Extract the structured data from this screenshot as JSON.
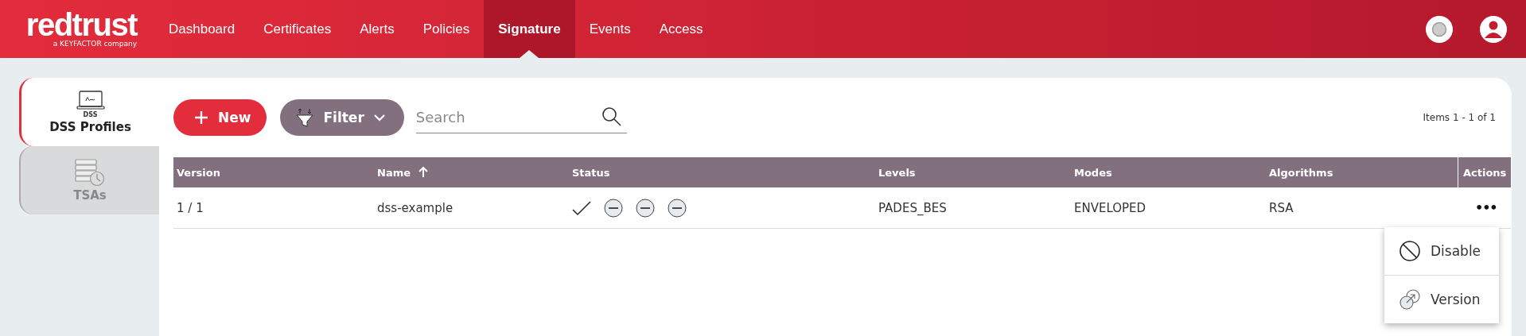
{
  "brand": {
    "name": "redtrust",
    "tagline": "a KEYFACTOR company"
  },
  "nav": [
    {
      "label": "Dashboard",
      "selected": false
    },
    {
      "label": "Certificates",
      "selected": false
    },
    {
      "label": "Alerts",
      "selected": false
    },
    {
      "label": "Policies",
      "selected": false
    },
    {
      "label": "Signature",
      "selected": true
    },
    {
      "label": "Events",
      "selected": false
    },
    {
      "label": "Access",
      "selected": false
    }
  ],
  "side_tabs": [
    {
      "label": "DSS Profiles",
      "icon_caption": "DSS",
      "kind": "dss",
      "selected": true
    },
    {
      "label": "TSAs",
      "kind": "tsa",
      "selected": false
    }
  ],
  "toolbar": {
    "new_label": "New",
    "filter_label": "Filter",
    "search": {
      "placeholder": "Search"
    },
    "items_count": "Items 1 - 1 of 1"
  },
  "table": {
    "columns": [
      {
        "label": "Version",
        "sorted": false
      },
      {
        "label": "Name",
        "sorted": true
      },
      {
        "label": "Status",
        "sorted": false
      },
      {
        "label": "Levels",
        "sorted": false
      },
      {
        "label": "Modes",
        "sorted": false
      },
      {
        "label": "Algorithms",
        "sorted": false
      },
      {
        "label": "Actions",
        "sorted": false
      }
    ],
    "rows": [
      {
        "version": "1 / 1",
        "name": "dss-example",
        "status": [
          {
            "kind": "check"
          },
          {
            "kind": "neutral"
          },
          {
            "kind": "neutral"
          },
          {
            "kind": "neutral"
          }
        ],
        "levels": "PADES_BES",
        "modes": "ENVELOPED",
        "algorithms": "RSA",
        "actions": "•••"
      }
    ]
  },
  "menu": [
    {
      "label": "Disable",
      "kind": "disable"
    },
    {
      "label": "Version",
      "kind": "version"
    }
  ]
}
